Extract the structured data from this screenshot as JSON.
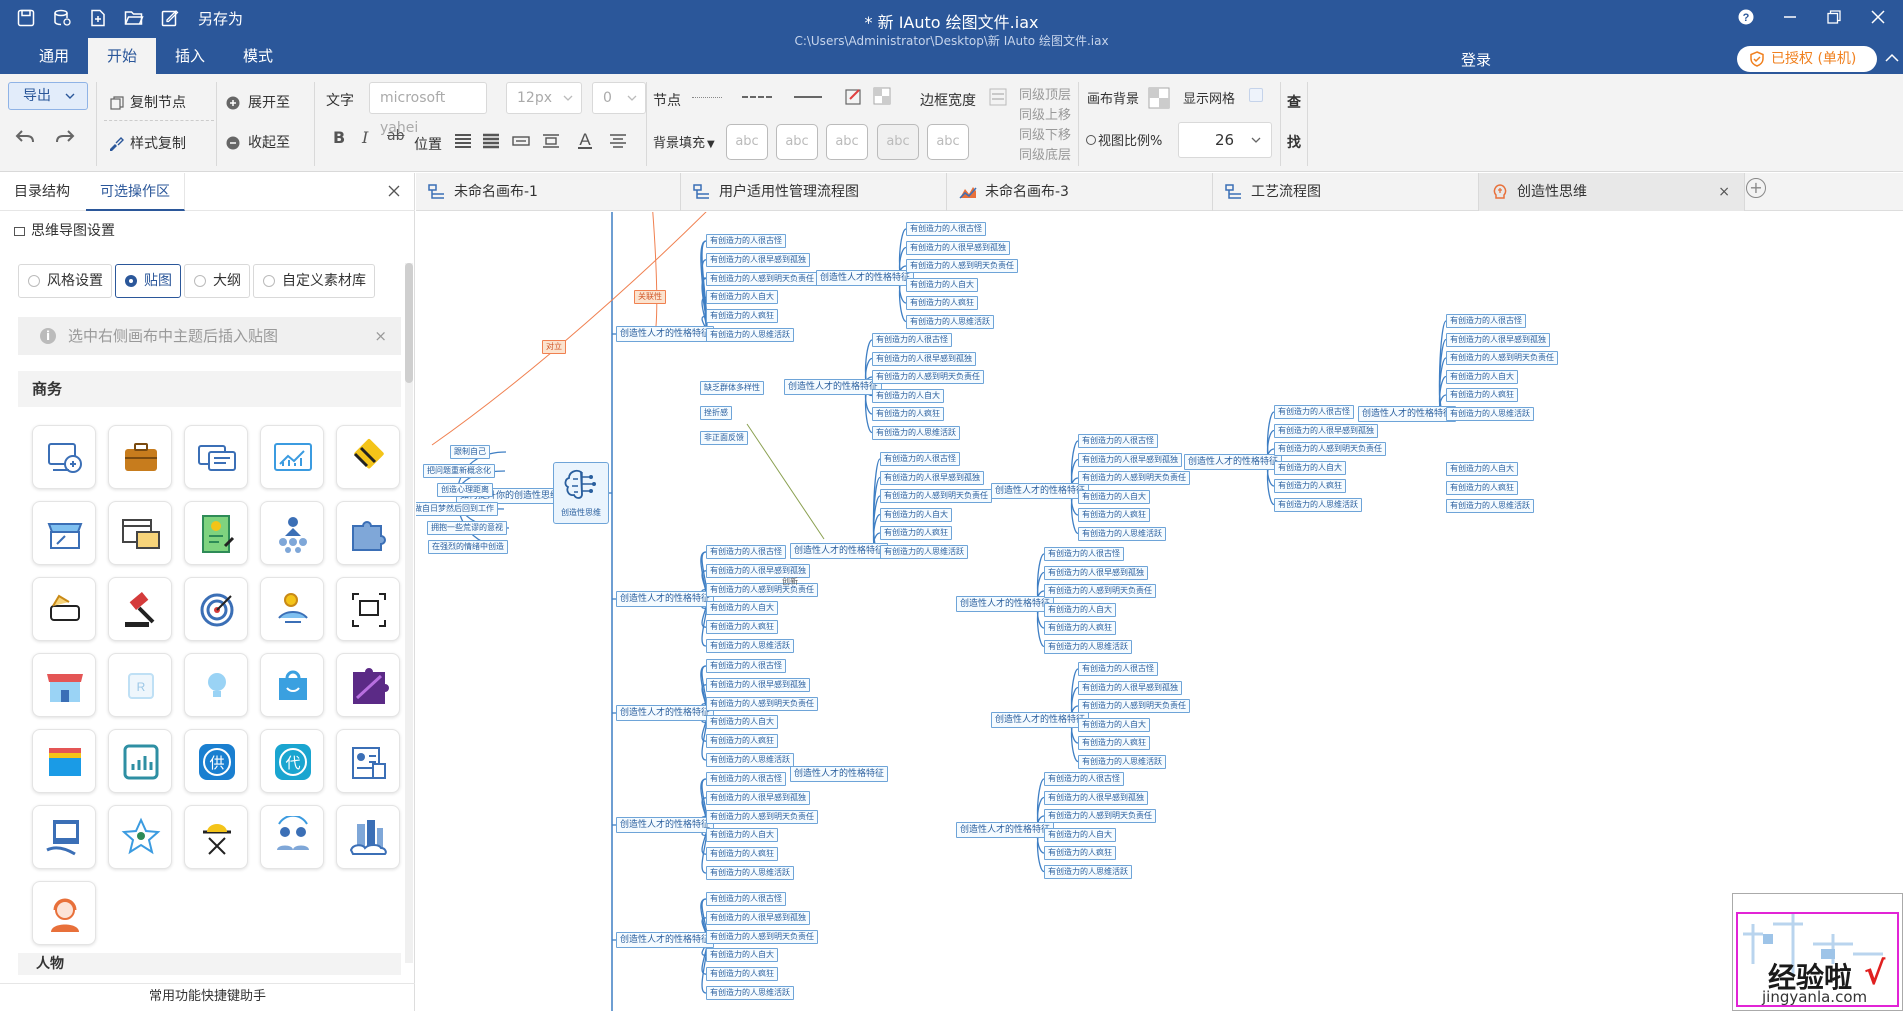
{
  "titlebar": {
    "save_as": "另存为",
    "doc_title": "*  新 IAuto 绘图文件.iax",
    "doc_path": "C:\\Users\\Administrator\\Desktop\\新 IAuto 绘图文件.iax"
  },
  "menubar": {
    "menus": [
      "通用",
      "开始",
      "插入",
      "模式"
    ],
    "active_menu": "开始",
    "login": "登录",
    "license": "已授权 (单机)"
  },
  "ribbon": {
    "export": "导出",
    "copy_node": "复制节点",
    "style_copy": "样式复制",
    "expand_to": "展开至",
    "collapse_to": "收起至",
    "text_label": "文字",
    "font_family": "microsoft yahei",
    "font_size": "12px",
    "font_spacing": "0",
    "position_label": "位置",
    "node_label": "节点",
    "border_width": "边框宽度",
    "same_top": "同级顶层",
    "same_up": "同级上移",
    "same_down": "同级下移",
    "same_bottom": "同级底层",
    "bg_fill": "背景填充",
    "abc": "abc",
    "canvas_bg": "画布背景",
    "show_grid": "显示网格",
    "view_ratio_label": "视图比例%",
    "view_ratio": "26",
    "find": [
      "查",
      "找"
    ]
  },
  "leftpanel": {
    "tabs": [
      "目录结构",
      "可选操作区"
    ],
    "active_tab": "可选操作区",
    "mindmap_settings": "思维导图设置",
    "modes": [
      "风格设置",
      "贴图",
      "大纲",
      "自定义素材库"
    ],
    "active_mode": "贴图",
    "hint": "选中右侧画布中主题后插入贴图",
    "category": "商务",
    "next_category": "人物",
    "shortcut_helper": "常用功能快捷键助手"
  },
  "doctabs": {
    "tabs": [
      "未命名画布-1",
      "用户适用性管理流程图",
      "未命名画布-3",
      "工艺流程图",
      "创造性思维"
    ],
    "active": "创造性思维"
  },
  "canvas": {
    "center": "创造性思维",
    "relation_labels": [
      "关联性",
      "对立",
      "创新"
    ],
    "left_branch": "如何提升你的创造性思维",
    "left_leaves": [
      "跟制自己",
      "把问题重新概念化",
      "创造心理距离",
      "做自日梦然后回到工作",
      "拥抱一些荒谬的意视",
      "在强烈的情绪中创造"
    ],
    "top_leaves": [
      "缺乏群体多样性",
      "挫折感",
      "非正面反馈"
    ],
    "level1": "创造性人才的性格特征",
    "traits": [
      "有创造力的人很古怪",
      "有创造力的人很早感到孤独",
      "有创造力的人感到明天负责任",
      "有创造力的人自大",
      "有创造力的人疯狂",
      "有创造力的人思维活跃"
    ]
  },
  "watermark": {
    "brand": "经验啦",
    "site": "jingyanla.com"
  },
  "colors": {
    "primary": "#2b579a",
    "accent": "#f0801f",
    "node_border": "#6ea4d8",
    "node_text": "#2a5f9e",
    "relation": "#f08050"
  }
}
